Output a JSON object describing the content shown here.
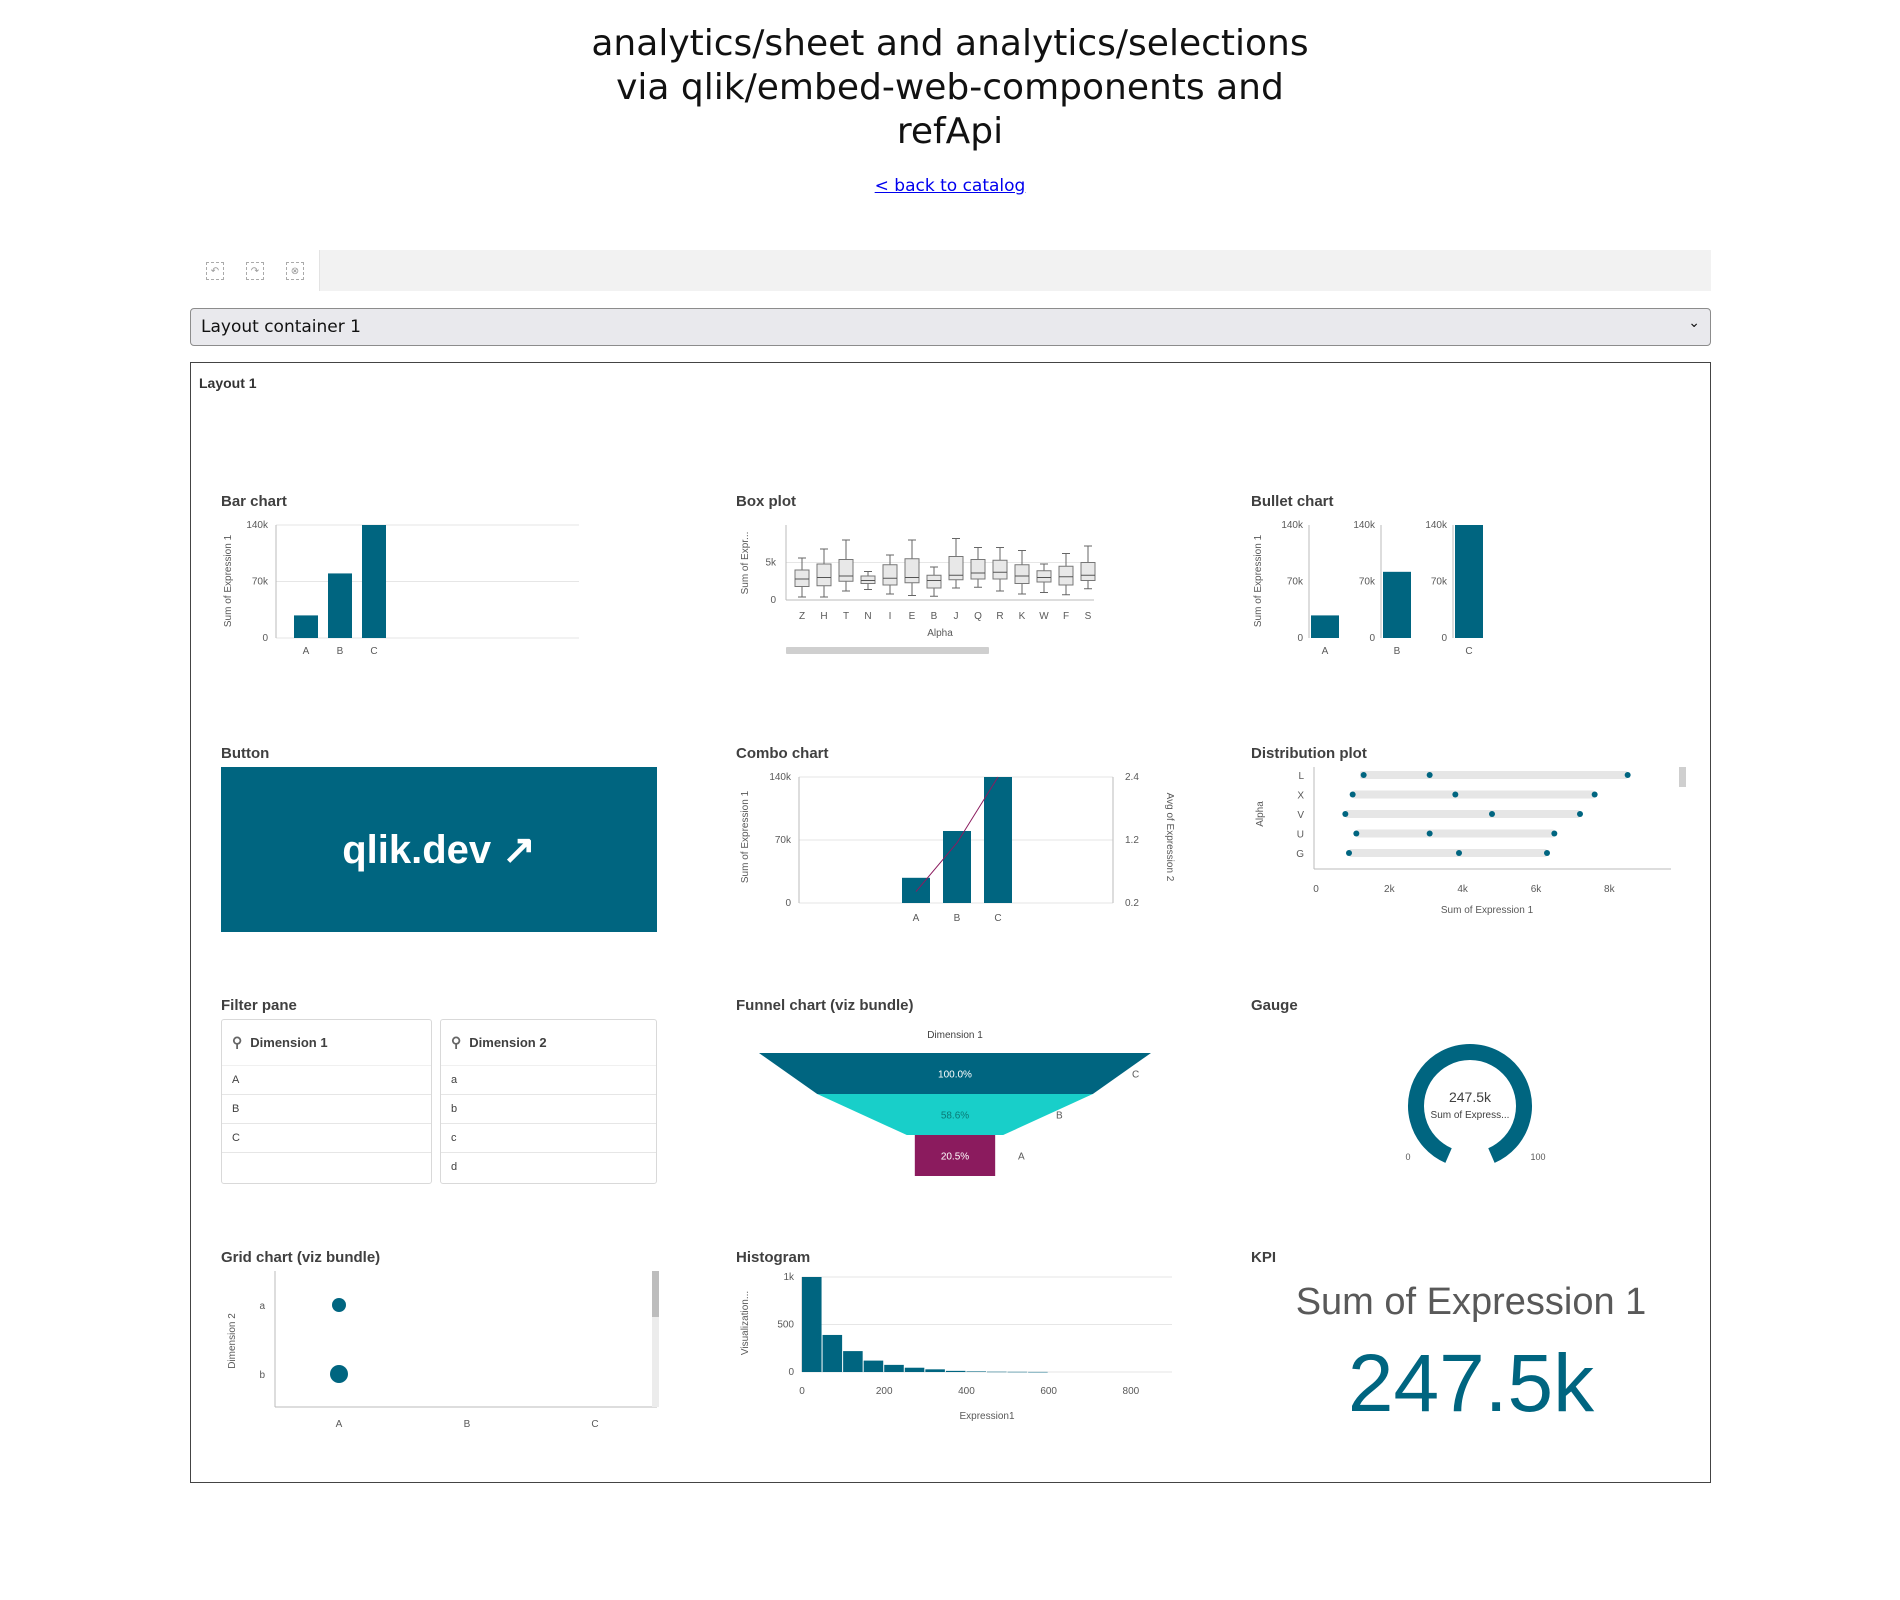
{
  "page": {
    "title_lines": [
      "analytics/sheet and analytics/selections",
      "via qlik/embed-web-components and",
      "refApi"
    ],
    "back_link": "< back to catalog"
  },
  "toolbar": {
    "icons": [
      "undo-icon",
      "redo-icon",
      "clear-selections-icon"
    ]
  },
  "layout_select": {
    "value": "Layout container 1"
  },
  "layout": {
    "title": "Layout 1",
    "viz_titles": {
      "bar": "Bar chart",
      "box": "Box plot",
      "bullet": "Bullet chart",
      "button": "Button",
      "combo": "Combo chart",
      "distribution": "Distribution plot",
      "filter": "Filter pane",
      "funnel": "Funnel chart (viz bundle)",
      "gauge": "Gauge",
      "grid": "Grid chart (viz bundle)",
      "histogram": "Histogram",
      "kpi": "KPI"
    },
    "button_label": "qlik.dev ↗",
    "filter_pane": {
      "dim1": {
        "title": "Dimension 1",
        "items": [
          "A",
          "B",
          "C",
          ""
        ]
      },
      "dim2": {
        "title": "Dimension 2",
        "items": [
          "a",
          "b",
          "c",
          "d"
        ]
      }
    },
    "kpi": {
      "title": "Sum of Expression 1",
      "value": "247.5k"
    },
    "accent": "#006580"
  },
  "chart_data": [
    {
      "id": "bar",
      "type": "bar",
      "categories": [
        "A",
        "B",
        "C"
      ],
      "values": [
        28000,
        80000,
        140000
      ],
      "ylabel": "Sum of Expression 1",
      "yticks": [
        "0",
        "70k",
        "140k"
      ],
      "ylim": [
        0,
        140000
      ]
    },
    {
      "id": "box",
      "type": "box",
      "categories": [
        "Z",
        "H",
        "T",
        "N",
        "I",
        "E",
        "B",
        "J",
        "Q",
        "R",
        "K",
        "W",
        "F",
        "S"
      ],
      "boxes": [
        [
          400,
          1800,
          2800,
          4000,
          5600
        ],
        [
          400,
          1900,
          3000,
          4800,
          6800
        ],
        [
          1200,
          2500,
          3200,
          5400,
          8000
        ],
        [
          1400,
          2200,
          2600,
          3200,
          3800
        ],
        [
          800,
          2000,
          2900,
          4700,
          6000
        ],
        [
          600,
          2300,
          3000,
          5500,
          8000
        ],
        [
          500,
          1600,
          2600,
          3300,
          4400
        ],
        [
          1600,
          2700,
          3300,
          5800,
          8200
        ],
        [
          1700,
          2800,
          3600,
          5400,
          7000
        ],
        [
          1200,
          2800,
          3700,
          5300,
          7000
        ],
        [
          800,
          2200,
          3200,
          4700,
          6600
        ],
        [
          1000,
          2400,
          3000,
          3900,
          4800
        ],
        [
          700,
          2000,
          3100,
          4500,
          6200
        ],
        [
          1500,
          2600,
          3300,
          5000,
          7200
        ]
      ],
      "xlabel": "Alpha",
      "ylabel": "Sum of Expr...",
      "yticks": [
        "0",
        "5k"
      ],
      "ylim": [
        0,
        10000
      ]
    },
    {
      "id": "bullet",
      "type": "bar",
      "categories": [
        "A",
        "B",
        "C"
      ],
      "values": [
        28000,
        82000,
        140000
      ],
      "ylabel": "Sum of Expression 1",
      "yticks": [
        "0",
        "70k",
        "140k"
      ],
      "ylim": [
        0,
        140000
      ]
    },
    {
      "id": "combo",
      "type": "bar",
      "categories": [
        "A",
        "B",
        "C"
      ],
      "values": [
        28000,
        80000,
        140000
      ],
      "line_values": [
        0.4,
        1.25,
        2.4
      ],
      "ylabel": "Sum of Expression 1",
      "y2label": "Avg of Expression 2",
      "yticks": [
        "0",
        "70k",
        "140k"
      ],
      "y2ticks": [
        "0.2",
        "1.2",
        "2.4"
      ],
      "ylim": [
        0,
        140000
      ],
      "y2lim": [
        0.2,
        2.4
      ]
    },
    {
      "id": "distribution",
      "type": "scatter",
      "categories": [
        "L",
        "X",
        "V",
        "U",
        "G"
      ],
      "ranges": [
        [
          1200,
          8500
        ],
        [
          1000,
          7600
        ],
        [
          800,
          7200
        ],
        [
          1100,
          6500
        ],
        [
          900,
          6300
        ]
      ],
      "points": [
        [
          1300,
          3100,
          8500
        ],
        [
          1000,
          3800,
          7600
        ],
        [
          800,
          4800,
          7200
        ],
        [
          1100,
          3100,
          6500
        ],
        [
          900,
          3900,
          6300
        ]
      ],
      "xlabel": "Sum of Expression 1",
      "ylabel": "Alpha",
      "xticks": [
        "0",
        "2k",
        "4k",
        "6k",
        "8k"
      ],
      "xlim": [
        0,
        9000
      ]
    },
    {
      "id": "funnel",
      "type": "funnel",
      "title": "Dimension 1",
      "categories": [
        "C",
        "B",
        "A"
      ],
      "labels": [
        "100.0%",
        "58.6%",
        "20.5%"
      ],
      "values": [
        100.0,
        58.6,
        20.5
      ],
      "colors": [
        "#006580",
        "#18cfc9",
        "#8b1b5e"
      ]
    },
    {
      "id": "gauge",
      "type": "gauge",
      "value_label": "247.5k",
      "measure_label": "Sum of Express...",
      "min_label": "0",
      "max_label": "100"
    },
    {
      "id": "grid",
      "type": "scatter",
      "x_categories": [
        "A",
        "B",
        "C"
      ],
      "y_categories": [
        "a",
        "b"
      ],
      "points": [
        {
          "x": "A",
          "y": "a",
          "size": 7
        },
        {
          "x": "A",
          "y": "b",
          "size": 9
        }
      ],
      "ylabel": "Dimension 2"
    },
    {
      "id": "histogram",
      "type": "bar",
      "bin_width": 50,
      "values": [
        1000,
        390,
        220,
        120,
        75,
        45,
        28,
        12,
        6,
        3,
        2,
        1
      ],
      "xticks": [
        "0",
        "200",
        "400",
        "600",
        "800"
      ],
      "xlim": [
        0,
        900
      ],
      "yticks": [
        "0",
        "500",
        "1k"
      ],
      "ylim": [
        0,
        1000
      ],
      "xlabel": "Expression1",
      "ylabel": "Visualization..."
    }
  ]
}
